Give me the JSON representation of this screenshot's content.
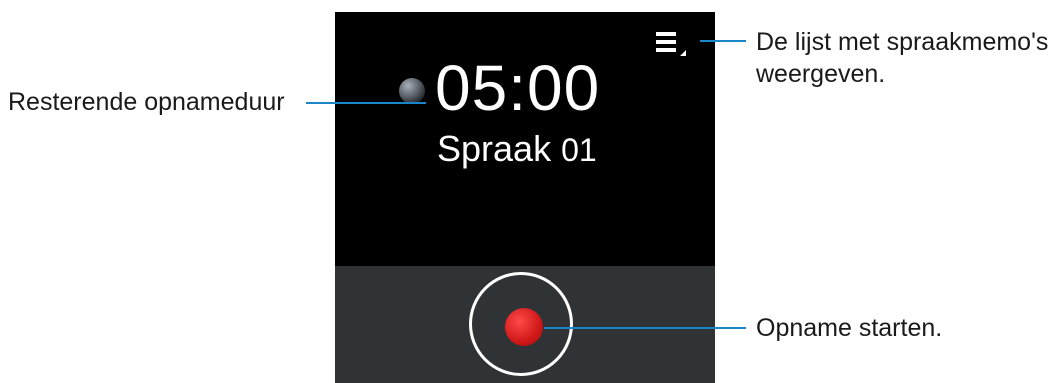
{
  "screen": {
    "remaining_time": "05:00",
    "memo_name": "Spraak",
    "memo_number": "01",
    "icons": {
      "list": "list-icon",
      "record": "record-icon",
      "indicator": "indicator-icon"
    },
    "colors": {
      "background": "#000000",
      "bottom_bar": "#2f3336",
      "record": "#d01818",
      "callout": "#1a86c9"
    }
  },
  "callouts": {
    "remaining": "Resterende opnameduur",
    "list_line1": "De lijst met spraakmemo's",
    "list_line2": "weergeven.",
    "record": "Opname starten."
  }
}
